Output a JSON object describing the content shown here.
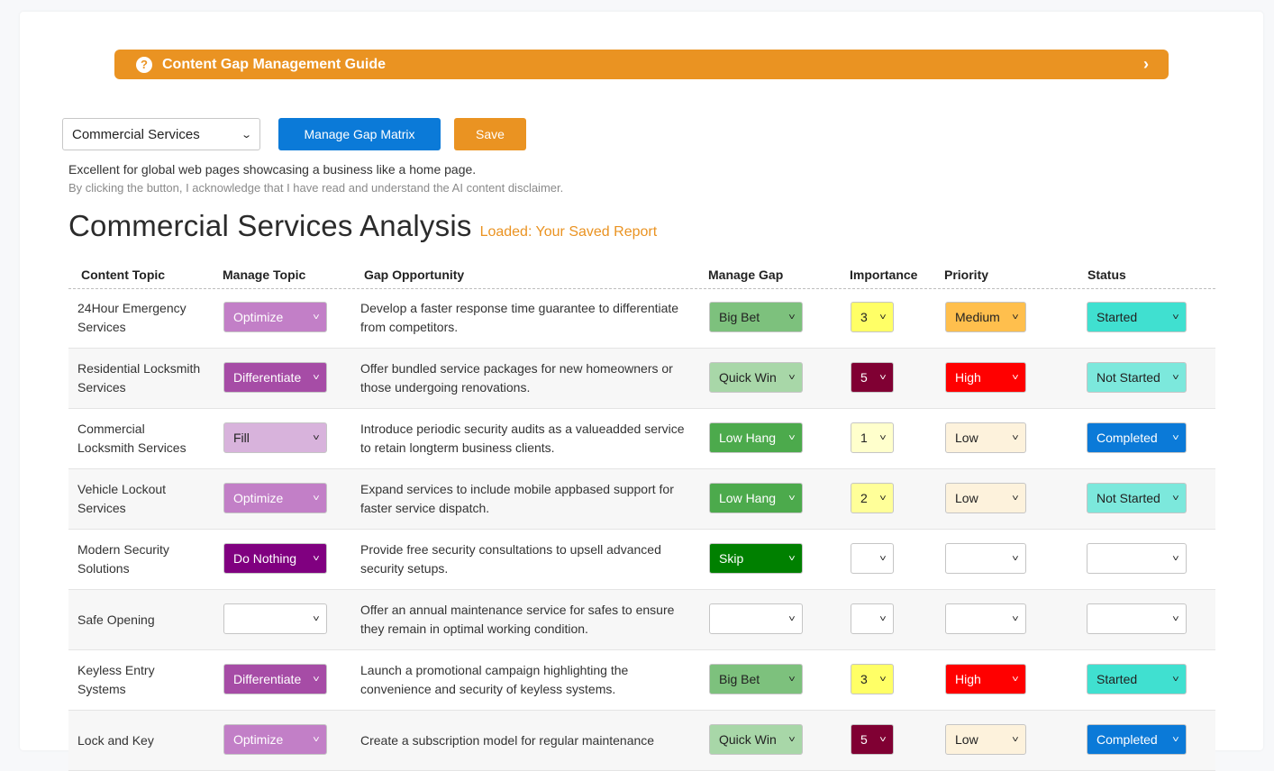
{
  "guide": {
    "title": "Content Gap Management Guide",
    "help_icon": "?",
    "chevron": "›"
  },
  "controls": {
    "selected_category": "Commercial Services",
    "manage_label": "Manage Gap Matrix",
    "save_label": "Save"
  },
  "description": "Excellent for global web pages showcasing a business like a home page.",
  "disclaimer": "By clicking the button, I acknowledge that I have read and understand the AI content disclaimer.",
  "report": {
    "title": "Commercial Services Analysis",
    "status": "Loaded: Your Saved Report"
  },
  "columns": {
    "topic": "Content Topic",
    "manage_topic": "Manage Topic",
    "gap": "Gap Opportunity",
    "manage_gap": "Manage Gap",
    "importance": "Importance",
    "priority": "Priority",
    "status": "Status"
  },
  "colors": {
    "accent_orange": "#ea9322",
    "button_blue": "#0b7ad8",
    "Optimize": "#c27fc7",
    "Differentiate": "#a64ca6",
    "Fill": "#d8b3dc",
    "Do Nothing": "#800080",
    "Big Bet": "#7dc17d",
    "Quick Win": "#a8d7a8",
    "Low Hang": "#4caa4c",
    "Skip": "#008000",
    "imp_3": "#ffff66",
    "imp_5": "#800033",
    "imp_1": "#ffffcc",
    "imp_2": "#ffff99",
    "Medium": "#ffbf4d",
    "High": "#ff0000",
    "Low": "#fdf2dc",
    "Started": "#40e0d0",
    "Not Started": "#7ce8dc",
    "Completed": "#0b7ad8"
  },
  "rows": [
    {
      "topic": "24Hour Emergency Services",
      "manage_topic": "Optimize",
      "gap": "Develop a faster response time guarantee to differentiate from competitors.",
      "manage_gap": "Big Bet",
      "importance": "3",
      "priority": "Medium",
      "status": "Started"
    },
    {
      "topic": "Residential Locksmith Services",
      "manage_topic": "Differentiate",
      "gap": "Offer bundled service packages for new homeowners or those undergoing renovations.",
      "manage_gap": "Quick Win",
      "importance": "5",
      "priority": "High",
      "status": "Not Started"
    },
    {
      "topic": "Commercial Locksmith Services",
      "manage_topic": "Fill",
      "gap": "Introduce periodic security audits as a valueadded service to retain longterm business clients.",
      "manage_gap": "Low Hang",
      "importance": "1",
      "priority": "Low",
      "status": "Completed"
    },
    {
      "topic": "Vehicle Lockout Services",
      "manage_topic": "Optimize",
      "gap": "Expand services to include mobile appbased support for faster service dispatch.",
      "manage_gap": "Low Hang",
      "importance": "2",
      "priority": "Low",
      "status": "Not Started"
    },
    {
      "topic": "Modern Security Solutions",
      "manage_topic": "Do Nothing",
      "gap": "Provide free security consultations to upsell advanced security setups.",
      "manage_gap": "Skip",
      "importance": "",
      "priority": "",
      "status": ""
    },
    {
      "topic": "Safe Opening",
      "manage_topic": "",
      "gap": "Offer an annual maintenance service for safes to ensure they remain in optimal working condition.",
      "manage_gap": "",
      "importance": "",
      "priority": "",
      "status": ""
    },
    {
      "topic": "Keyless Entry Systems",
      "manage_topic": "Differentiate",
      "gap": "Launch a promotional campaign highlighting the convenience and security of keyless systems.",
      "manage_gap": "Big Bet",
      "importance": "3",
      "priority": "High",
      "status": "Started"
    },
    {
      "topic": "Lock and Key",
      "manage_topic": "Optimize",
      "gap": "Create a subscription model for regular maintenance",
      "manage_gap": "Quick Win",
      "importance": "5",
      "priority": "Low",
      "status": "Completed"
    }
  ]
}
